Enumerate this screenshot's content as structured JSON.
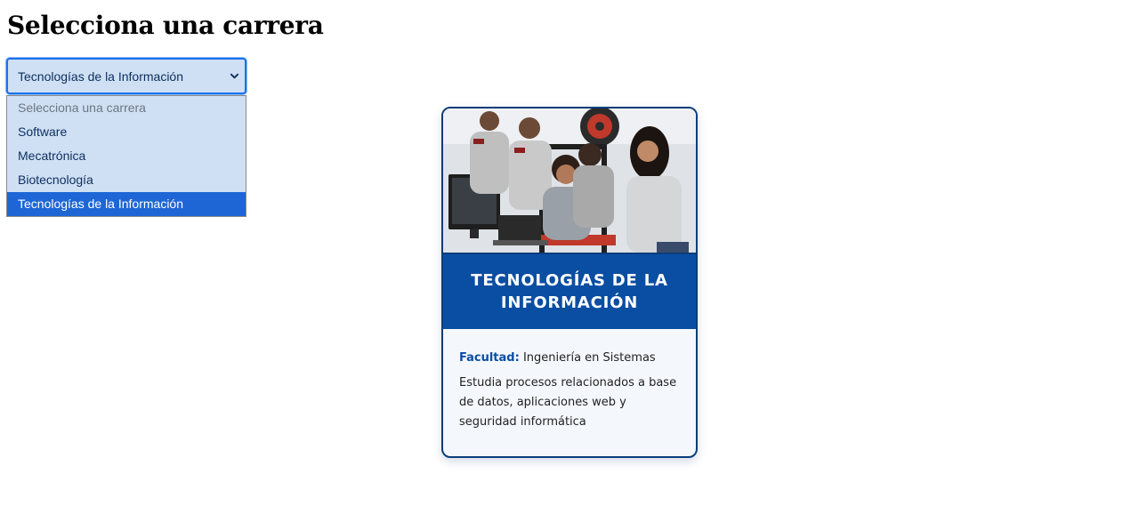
{
  "page": {
    "title": "Selecciona una carrera"
  },
  "select": {
    "value": "Tecnologías de la Información",
    "options": [
      {
        "label": "Selecciona una carrera",
        "placeholder": true
      },
      {
        "label": "Software"
      },
      {
        "label": "Mecatrónica"
      },
      {
        "label": "Biotecnología"
      },
      {
        "label": "Tecnologías de la Información",
        "selected": true
      }
    ]
  },
  "card": {
    "title": "Tecnologías de la Información",
    "faculty_label": "Facultad:",
    "faculty_value": "Ingeniería en Sistemas",
    "description": "Estudia procesos relacionados a base de datos, aplicaciones web y seguridad informática",
    "image_icon": "students-lab-photo"
  },
  "colors": {
    "accent": "#1a73e8",
    "card_header": "#0a4ea3",
    "card_border": "#0a3d7a",
    "select_bg": "#cfe0f5",
    "selected_option": "#1e66d6"
  }
}
